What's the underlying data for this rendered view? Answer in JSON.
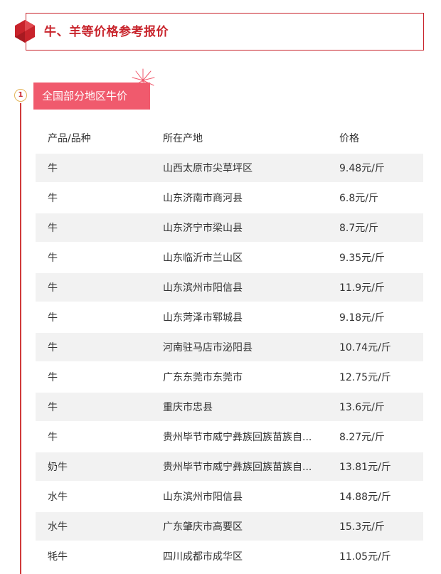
{
  "header": {
    "title": "牛、羊等价格参考报价",
    "accent_color": "#c8232b"
  },
  "section": {
    "number": "1",
    "title": "全国部分地区牛价",
    "tag_color": "#f05a6d"
  },
  "table": {
    "headers": [
      "产品/品种",
      "所在产地",
      "价格"
    ],
    "rows": [
      [
        "牛",
        "山西太原市尖草坪区",
        "9.48元/斤"
      ],
      [
        "牛",
        "山东济南市商河县",
        "6.8元/斤"
      ],
      [
        "牛",
        "山东济宁市梁山县",
        "8.7元/斤"
      ],
      [
        "牛",
        "山东临沂市兰山区",
        "9.35元/斤"
      ],
      [
        "牛",
        "山东滨州市阳信县",
        "11.9元/斤"
      ],
      [
        "牛",
        "山东菏泽市郓城县",
        "9.18元/斤"
      ],
      [
        "牛",
        "河南驻马店市泌阳县",
        "10.74元/斤"
      ],
      [
        "牛",
        "广东东莞市东莞市",
        "12.75元/斤"
      ],
      [
        "牛",
        "重庆市忠县",
        "13.6元/斤"
      ],
      [
        "牛",
        "贵州毕节市威宁彝族回族苗族自...",
        "8.27元/斤"
      ],
      [
        "奶牛",
        "贵州毕节市威宁彝族回族苗族自...",
        "13.81元/斤"
      ],
      [
        "水牛",
        "山东滨州市阳信县",
        "14.88元/斤"
      ],
      [
        "水牛",
        "广东肇庆市高要区",
        "15.3元/斤"
      ],
      [
        "牦牛",
        "四川成都市成华区",
        "11.05元/斤"
      ]
    ]
  },
  "icons": {
    "header": "hexagon-icon",
    "section": "firework-icon"
  }
}
